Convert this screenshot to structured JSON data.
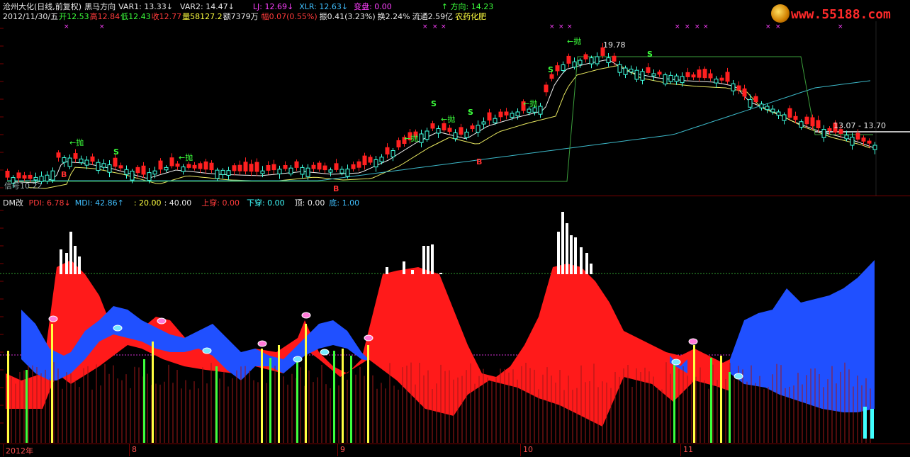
{
  "header": {
    "line1": [
      {
        "text": "沧州大化(日线,前复权)",
        "color": "#e8e8e8"
      },
      {
        "text": "黑马方向",
        "color": "#e8e8e8"
      },
      {
        "text": "VAR1: 13.33↓",
        "color": "#e8e8e8"
      },
      {
        "text": "VAR2: 14.47↓",
        "color": "#e8e8e8"
      },
      {
        "text": "LJ: 12.69↓",
        "color": "#ff40ff"
      },
      {
        "text": "XLR: 12.63↓",
        "color": "#40c0ff"
      },
      {
        "text": "变盘: 0.00",
        "color": "#ff40ff"
      },
      {
        "text": "↑ 方向: 14.23",
        "color": "#3cff3c"
      }
    ],
    "line2": [
      {
        "text": "2012/11/30/五",
        "color": "#e8e8e8"
      },
      {
        "text": "开12.53",
        "color": "#3cff3c"
      },
      {
        "text": "高12.84",
        "color": "#ff3b3b"
      },
      {
        "text": "低12.43",
        "color": "#3cff3c"
      },
      {
        "text": "收12.77",
        "color": "#ff3b3b"
      },
      {
        "text": "量58127.2",
        "color": "#ffff40"
      },
      {
        "text": "额7379万",
        "color": "#e8e8e8"
      },
      {
        "text": "幅0.07(0.55%)",
        "color": "#ff3b3b"
      },
      {
        "text": "振0.41(3.23%)",
        "color": "#e8e8e8"
      },
      {
        "text": "换2.24%",
        "color": "#e8e8e8"
      },
      {
        "text": "流通2.59亿",
        "color": "#e8e8e8"
      },
      {
        "text": "农药化肥",
        "color": "#ffff40"
      }
    ]
  },
  "price_labels": {
    "high": "19.78",
    "range": "13.07 - 13.70",
    "low_prefix": "信号",
    "low_value": "10.22"
  },
  "indicator": {
    "name": "DM改",
    "values": [
      {
        "text": "PDI: 6.78↓",
        "color": "#ff3b3b"
      },
      {
        "text": "MDI: 42.86↑",
        "color": "#40c0ff"
      },
      {
        "text": ": 20.00",
        "color": "#ffff40"
      },
      {
        "text": ": 40.00",
        "color": "#e8e8e8"
      },
      {
        "text": "上穿: 0.00",
        "color": "#ff3b3b"
      },
      {
        "text": "下穿: 0.00",
        "color": "#40ffff"
      },
      {
        "text": "顶: 0.00",
        "color": "#e8e8e8"
      },
      {
        "text": "底: 1.00",
        "color": "#40c0ff"
      }
    ]
  },
  "markers": {
    "sell": "S",
    "buy": "B",
    "throw": "←抛"
  },
  "time_axis": [
    "2012年",
    "8",
    "9",
    "10",
    "11"
  ],
  "watermark": "www.55188.com"
}
